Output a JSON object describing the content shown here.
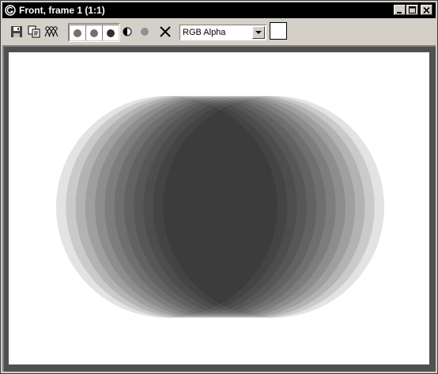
{
  "window": {
    "title": "Front, frame 1 (1:1)",
    "title_bar_color": "#000000",
    "title_icon": "app-logo-icon",
    "controls": [
      "minimize-icon",
      "maximize-icon",
      "close-icon"
    ]
  },
  "toolbar": {
    "tools": [
      {
        "name": "save-image",
        "icon": "floppy-disk-icon"
      },
      {
        "name": "clone-window",
        "icon": "copy-icon"
      },
      {
        "name": "print",
        "icon": "people-icon"
      }
    ],
    "channels": [
      {
        "name": "red-channel",
        "icon": "filled-circle-icon"
      },
      {
        "name": "green-channel",
        "icon": "filled-circle-icon"
      },
      {
        "name": "blue-channel",
        "icon": "filled-circle-icon"
      },
      {
        "name": "alpha-channel",
        "icon": "half-circle-icon"
      },
      {
        "name": "mono",
        "icon": "filled-circle-icon"
      }
    ],
    "clear_icon": "x-icon",
    "display_channel": {
      "selected": "RGB Alpha"
    },
    "swatch_color": "#ffffff"
  },
  "viewport": {
    "background": "#ffffff",
    "frame_color": "#505050",
    "content": "overlapping translucent grey circles forming an ellipse"
  }
}
